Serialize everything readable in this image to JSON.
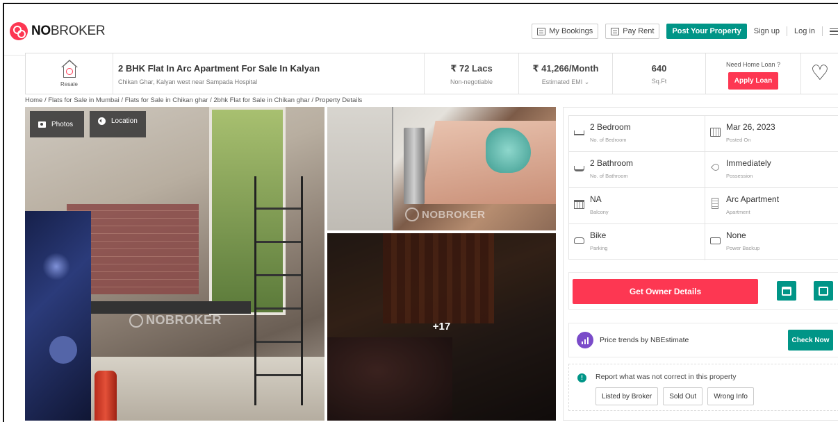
{
  "brand": {
    "logo_bold": "NO",
    "logo_rest": "BROKER"
  },
  "topnav": {
    "my_bookings": "My Bookings",
    "pay_rent": "Pay Rent",
    "post_property": "Post Your Property",
    "sign_up": "Sign up",
    "log_in": "Log in"
  },
  "listing": {
    "badge": "Resale",
    "title": "2 BHK Flat In Arc Apartment For Sale In Kalyan",
    "address": "Chikan Ghar, Kalyan west near Sampada Hospital",
    "price": "₹ 72 Lacs",
    "price_note": "Non-negotiable",
    "emi": "₹ 41,266/Month",
    "emi_note": "Estimated EMI ⌄",
    "area": "640",
    "area_unit": "Sq.Ft",
    "loan_question": "Need Home Loan ?",
    "apply_loan": "Apply Loan"
  },
  "breadcrumb": "Home / Flats for Sale in Mumbai / Flats for Sale in Chikan ghar / 2bhk Flat for Sale in Chikan ghar / Property Details",
  "gallery": {
    "photos_label": "Photos",
    "location_label": "Location",
    "watermark": "NOBROKER",
    "more_count": "+17"
  },
  "facts": [
    {
      "value": "2 Bedroom",
      "label": "No. of Bedroom",
      "icon": "bed-icon"
    },
    {
      "value": "Mar 26, 2023",
      "label": "Posted On",
      "icon": "calendar-icon"
    },
    {
      "value": "2 Bathroom",
      "label": "No. of Bathroom",
      "icon": "bathtub-icon"
    },
    {
      "value": "Immediately",
      "label": "Possession",
      "icon": "key-icon"
    },
    {
      "value": "NA",
      "label": "Balcony",
      "icon": "balcony-icon"
    },
    {
      "value": "Arc Apartment",
      "label": "Apartment",
      "icon": "building-icon"
    },
    {
      "value": "Bike",
      "label": "Parking",
      "icon": "car-icon"
    },
    {
      "value": "None",
      "label": "Power Backup",
      "icon": "power-backup-icon"
    }
  ],
  "actions": {
    "get_owner_details": "Get Owner Details"
  },
  "price_trend": {
    "text": "Price trends by NBEstimate",
    "check_now": "Check Now"
  },
  "report": {
    "text": "Report what was not correct in this property",
    "buttons": [
      "Listed by Broker",
      "Sold Out",
      "Wrong Info"
    ]
  },
  "colors": {
    "brand_red": "#fd3752",
    "brand_green": "#009587",
    "trend_purple": "#7a4bc9"
  }
}
